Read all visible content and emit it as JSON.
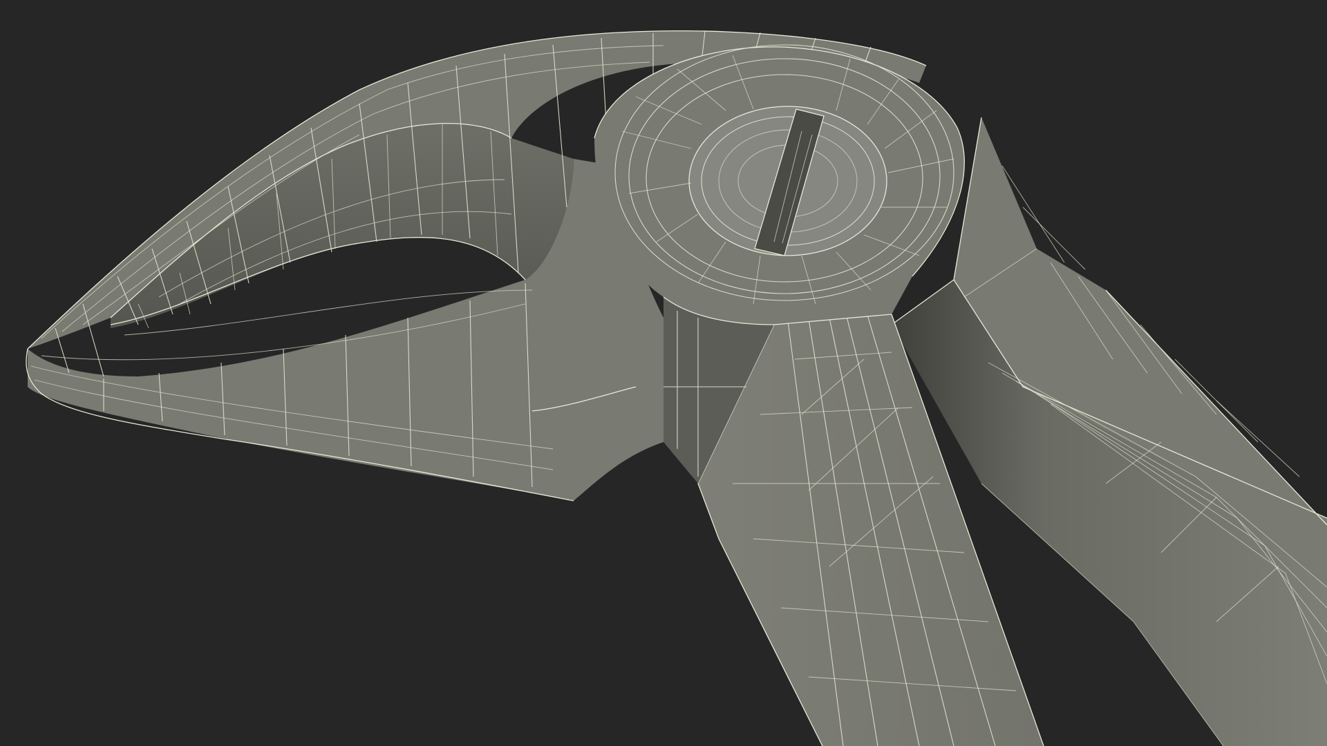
{
  "scene": {
    "background_color": "#262626",
    "model_color": "#797a71",
    "wire_color": "#e4e6d3",
    "render_mode": "wireframe-on-shaded"
  }
}
